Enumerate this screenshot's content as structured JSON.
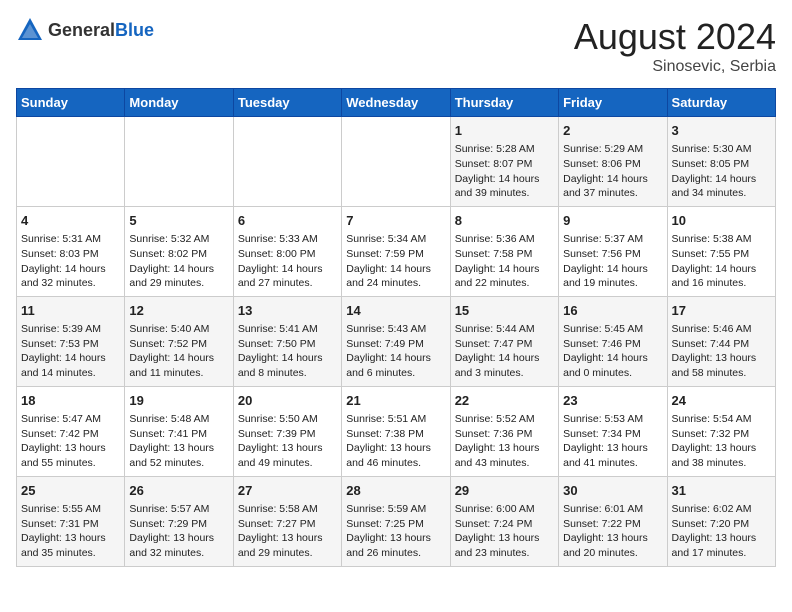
{
  "header": {
    "logo_general": "General",
    "logo_blue": "Blue",
    "month_year": "August 2024",
    "location": "Sinosevic, Serbia"
  },
  "days_of_week": [
    "Sunday",
    "Monday",
    "Tuesday",
    "Wednesday",
    "Thursday",
    "Friday",
    "Saturday"
  ],
  "weeks": [
    [
      {
        "day": "",
        "info": ""
      },
      {
        "day": "",
        "info": ""
      },
      {
        "day": "",
        "info": ""
      },
      {
        "day": "",
        "info": ""
      },
      {
        "day": "1",
        "sunrise": "5:28 AM",
        "sunset": "8:07 PM",
        "daylight": "14 hours and 39 minutes."
      },
      {
        "day": "2",
        "sunrise": "5:29 AM",
        "sunset": "8:06 PM",
        "daylight": "14 hours and 37 minutes."
      },
      {
        "day": "3",
        "sunrise": "5:30 AM",
        "sunset": "8:05 PM",
        "daylight": "14 hours and 34 minutes."
      }
    ],
    [
      {
        "day": "4",
        "sunrise": "5:31 AM",
        "sunset": "8:03 PM",
        "daylight": "14 hours and 32 minutes."
      },
      {
        "day": "5",
        "sunrise": "5:32 AM",
        "sunset": "8:02 PM",
        "daylight": "14 hours and 29 minutes."
      },
      {
        "day": "6",
        "sunrise": "5:33 AM",
        "sunset": "8:00 PM",
        "daylight": "14 hours and 27 minutes."
      },
      {
        "day": "7",
        "sunrise": "5:34 AM",
        "sunset": "7:59 PM",
        "daylight": "14 hours and 24 minutes."
      },
      {
        "day": "8",
        "sunrise": "5:36 AM",
        "sunset": "7:58 PM",
        "daylight": "14 hours and 22 minutes."
      },
      {
        "day": "9",
        "sunrise": "5:37 AM",
        "sunset": "7:56 PM",
        "daylight": "14 hours and 19 minutes."
      },
      {
        "day": "10",
        "sunrise": "5:38 AM",
        "sunset": "7:55 PM",
        "daylight": "14 hours and 16 minutes."
      }
    ],
    [
      {
        "day": "11",
        "sunrise": "5:39 AM",
        "sunset": "7:53 PM",
        "daylight": "14 hours and 14 minutes."
      },
      {
        "day": "12",
        "sunrise": "5:40 AM",
        "sunset": "7:52 PM",
        "daylight": "14 hours and 11 minutes."
      },
      {
        "day": "13",
        "sunrise": "5:41 AM",
        "sunset": "7:50 PM",
        "daylight": "14 hours and 8 minutes."
      },
      {
        "day": "14",
        "sunrise": "5:43 AM",
        "sunset": "7:49 PM",
        "daylight": "14 hours and 6 minutes."
      },
      {
        "day": "15",
        "sunrise": "5:44 AM",
        "sunset": "7:47 PM",
        "daylight": "14 hours and 3 minutes."
      },
      {
        "day": "16",
        "sunrise": "5:45 AM",
        "sunset": "7:46 PM",
        "daylight": "14 hours and 0 minutes."
      },
      {
        "day": "17",
        "sunrise": "5:46 AM",
        "sunset": "7:44 PM",
        "daylight": "13 hours and 58 minutes."
      }
    ],
    [
      {
        "day": "18",
        "sunrise": "5:47 AM",
        "sunset": "7:42 PM",
        "daylight": "13 hours and 55 minutes."
      },
      {
        "day": "19",
        "sunrise": "5:48 AM",
        "sunset": "7:41 PM",
        "daylight": "13 hours and 52 minutes."
      },
      {
        "day": "20",
        "sunrise": "5:50 AM",
        "sunset": "7:39 PM",
        "daylight": "13 hours and 49 minutes."
      },
      {
        "day": "21",
        "sunrise": "5:51 AM",
        "sunset": "7:38 PM",
        "daylight": "13 hours and 46 minutes."
      },
      {
        "day": "22",
        "sunrise": "5:52 AM",
        "sunset": "7:36 PM",
        "daylight": "13 hours and 43 minutes."
      },
      {
        "day": "23",
        "sunrise": "5:53 AM",
        "sunset": "7:34 PM",
        "daylight": "13 hours and 41 minutes."
      },
      {
        "day": "24",
        "sunrise": "5:54 AM",
        "sunset": "7:32 PM",
        "daylight": "13 hours and 38 minutes."
      }
    ],
    [
      {
        "day": "25",
        "sunrise": "5:55 AM",
        "sunset": "7:31 PM",
        "daylight": "13 hours and 35 minutes."
      },
      {
        "day": "26",
        "sunrise": "5:57 AM",
        "sunset": "7:29 PM",
        "daylight": "13 hours and 32 minutes."
      },
      {
        "day": "27",
        "sunrise": "5:58 AM",
        "sunset": "7:27 PM",
        "daylight": "13 hours and 29 minutes."
      },
      {
        "day": "28",
        "sunrise": "5:59 AM",
        "sunset": "7:25 PM",
        "daylight": "13 hours and 26 minutes."
      },
      {
        "day": "29",
        "sunrise": "6:00 AM",
        "sunset": "7:24 PM",
        "daylight": "13 hours and 23 minutes."
      },
      {
        "day": "30",
        "sunrise": "6:01 AM",
        "sunset": "7:22 PM",
        "daylight": "13 hours and 20 minutes."
      },
      {
        "day": "31",
        "sunrise": "6:02 AM",
        "sunset": "7:20 PM",
        "daylight": "13 hours and 17 minutes."
      }
    ]
  ]
}
